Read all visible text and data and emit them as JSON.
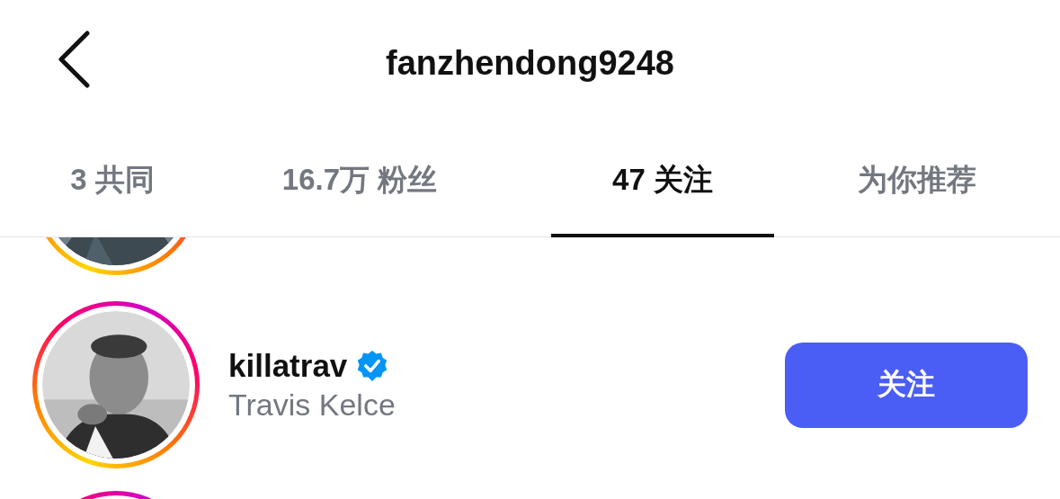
{
  "header": {
    "title": "fanzhendong9248"
  },
  "tabs": [
    {
      "label": "3 共同",
      "selected": false
    },
    {
      "label": "16.7万 粉丝",
      "selected": false
    },
    {
      "label": "47 关注",
      "selected": true
    },
    {
      "label": "为你推荐",
      "selected": false
    }
  ],
  "users": [
    {
      "kind": "cropped_top"
    },
    {
      "kind": "full",
      "username": "killatrav",
      "verified": true,
      "name": "Travis Kelce",
      "button": "关注"
    },
    {
      "kind": "cropped_bottom",
      "avatar": {
        "kind": "ring"
      }
    }
  ]
}
